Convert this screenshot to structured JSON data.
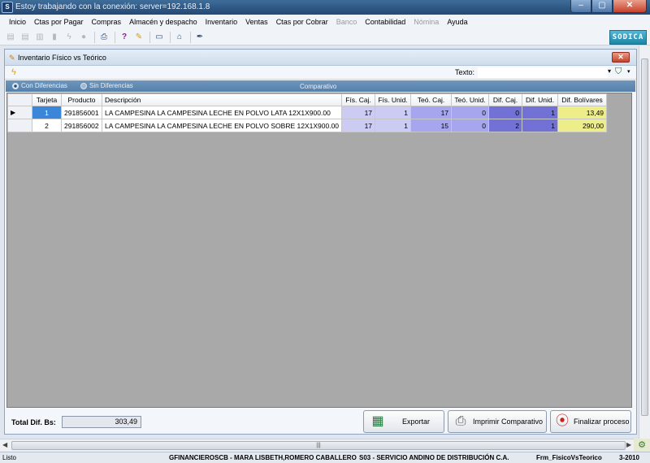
{
  "window": {
    "title": "Estoy trabajando con la conexión: server=192.168.1.8",
    "app_icon": "app-icon",
    "min": "–",
    "max": "▢",
    "close": "✕"
  },
  "menu": [
    "Inicio",
    "Ctas por Pagar",
    "Compras",
    "Almacén y despacho",
    "Inventario",
    "Ventas",
    "Ctas por Cobrar",
    "Banco",
    "Contabilidad",
    "Nómina",
    "Ayuda"
  ],
  "toolbar": {
    "icons": [
      "new-icon",
      "save-icon",
      "copy-icon",
      "delete-icon",
      "run-icon",
      "record-icon",
      "print-icon",
      "help-icon",
      "brush-icon",
      "printer-setup-icon",
      "bank-icon",
      "pen-icon"
    ],
    "brand": "SODICA"
  },
  "form": {
    "title": "Inventario Físico vs Teórico",
    "filter_label": "Texto:",
    "filter_value": "",
    "radio_with_diff": "Con Diferencias",
    "radio_without_diff": "Sin Diferencias",
    "group_label": "Comparativo"
  },
  "grid": {
    "columns": [
      "Tarjeta",
      "Producto",
      "Descripción",
      "Fís. Caj.",
      "Fís. Unid.",
      "Teó. Caj.",
      "Teó. Unid.",
      "Dif. Caj.",
      "Dif. Unid.",
      "Dif. Bolívares"
    ],
    "rows": [
      {
        "tarjeta": "1",
        "producto": "291856001",
        "descripcion": "LA CAMPESINA LA CAMPESINA LECHE EN POLVO LATA 12X1X900.00",
        "fis_caj": "17",
        "fis_unid": "1",
        "teo_caj": "17",
        "teo_unid": "0",
        "dif_caj": "0",
        "dif_unid": "1",
        "dif_bs": "13,49"
      },
      {
        "tarjeta": "2",
        "producto": "291856002",
        "descripcion": "LA CAMPESINA LA CAMPESINA LECHE EN POLVO SOBRE 12X1X900.00",
        "fis_caj": "17",
        "fis_unid": "1",
        "teo_caj": "15",
        "teo_unid": "0",
        "dif_caj": "2",
        "dif_unid": "1",
        "dif_bs": "290,00"
      }
    ]
  },
  "footer": {
    "total_label": "Total Dif. Bs:",
    "total_value": "303,49",
    "export": "Exportar",
    "print": "Imprimir Comparativo",
    "finish": "Finalizar proceso"
  },
  "status": {
    "ready": "Listo",
    "user": "GFINANCIEROSCB - MARA LISBETH,ROMERO CABALLERO",
    "company": "S03 - SERVICIO ANDINO DE DISTRIBUCIÓN C.A.",
    "form": "Frm_FisicoVsTeorico",
    "period": "3-2010"
  }
}
